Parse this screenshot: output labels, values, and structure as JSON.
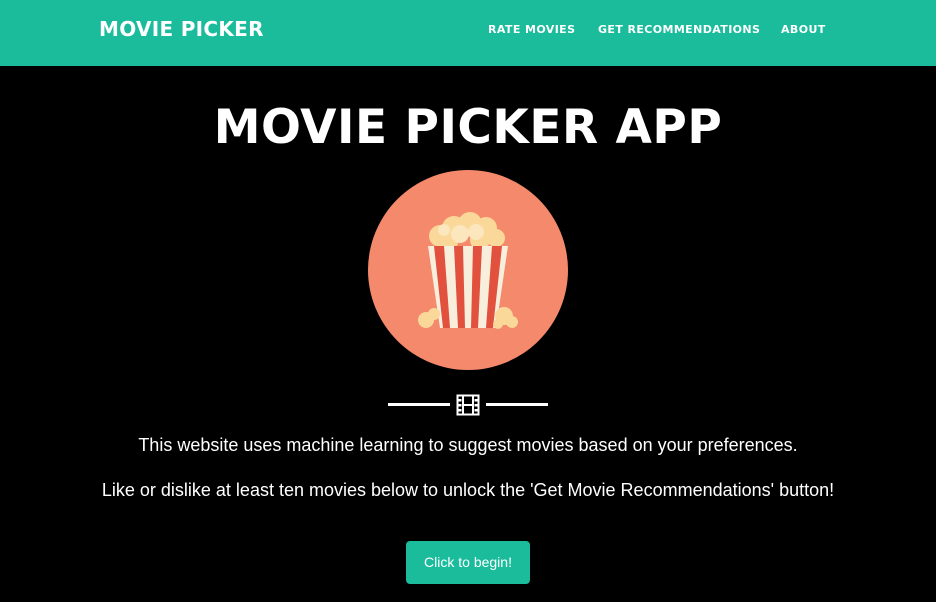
{
  "navbar": {
    "brand": "MOVIE PICKER",
    "links": [
      {
        "label": "RATE MOVIES"
      },
      {
        "label": "GET RECOMMENDATIONS"
      },
      {
        "label": "ABOUT"
      }
    ],
    "background_color": "#1abc9c"
  },
  "hero": {
    "title": "MOVIE PICKER APP",
    "avatar_icon": "popcorn-icon",
    "avatar_color": "#f4896b",
    "divider_icon": "film-icon",
    "paragraphs": [
      "This website uses machine learning to suggest movies based on your preferences.",
      "Like or dislike at least ten movies below to unlock the 'Get Movie Recommendations' button!"
    ],
    "button_label": "Click to begin!"
  }
}
